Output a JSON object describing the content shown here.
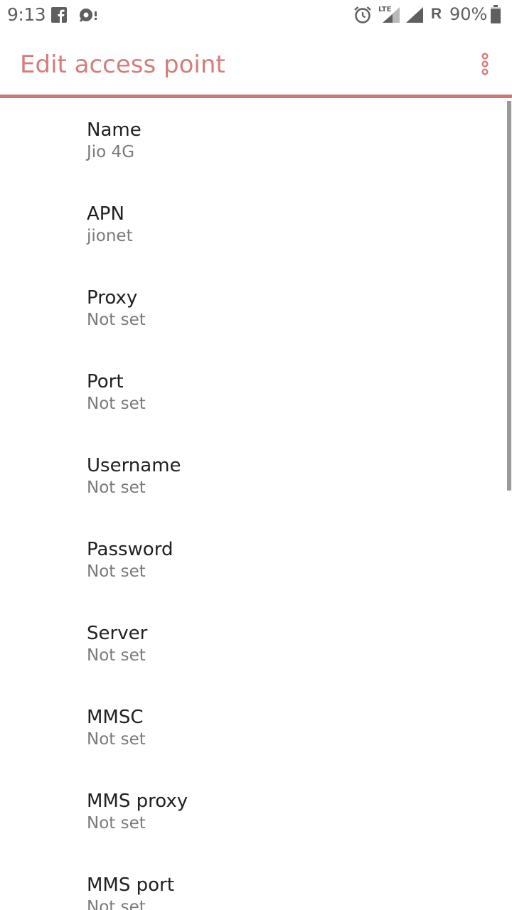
{
  "status_bar": {
    "time": "9:13",
    "battery": "90%",
    "roaming": "R",
    "lte": "LTE",
    "icons": [
      "facebook-icon",
      "notification-icon",
      "alarm-icon",
      "lte-signal-icon",
      "signal-icon",
      "battery-icon"
    ]
  },
  "app_bar": {
    "title": "Edit access point",
    "accent_color": "#d67c7c"
  },
  "preferences": [
    {
      "title": "Name",
      "summary": "Jio 4G"
    },
    {
      "title": "APN",
      "summary": "jionet"
    },
    {
      "title": "Proxy",
      "summary": "Not set"
    },
    {
      "title": "Port",
      "summary": "Not set"
    },
    {
      "title": "Username",
      "summary": "Not set"
    },
    {
      "title": "Password",
      "summary": "Not set"
    },
    {
      "title": "Server",
      "summary": "Not set"
    },
    {
      "title": "MMSC",
      "summary": "Not set"
    },
    {
      "title": "MMS proxy",
      "summary": "Not set"
    },
    {
      "title": "MMS port",
      "summary": "Not set"
    }
  ]
}
